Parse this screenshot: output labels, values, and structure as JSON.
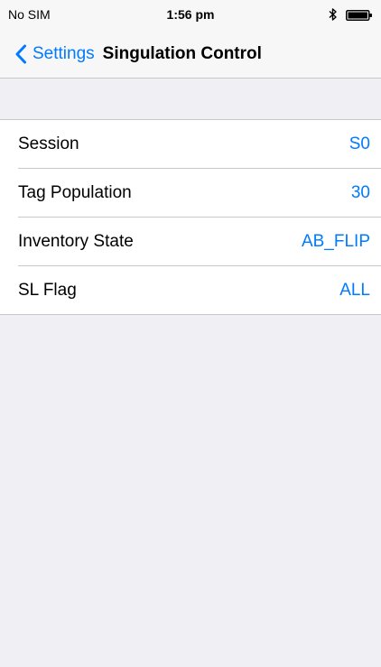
{
  "status_bar": {
    "carrier": "No SIM",
    "time": "1:56 pm",
    "icons": [
      "bluetooth-icon",
      "battery-icon"
    ]
  },
  "nav": {
    "back_label": "Settings",
    "title": "Singulation Control"
  },
  "rows": [
    {
      "label": "Session",
      "value": "S0"
    },
    {
      "label": "Tag Population",
      "value": "30"
    },
    {
      "label": "Inventory State",
      "value": "AB_FLIP"
    },
    {
      "label": "SL Flag",
      "value": "ALL"
    }
  ],
  "colors": {
    "accent": "#007aff",
    "background": "#efeff4",
    "separator": "#c8c7cc"
  }
}
